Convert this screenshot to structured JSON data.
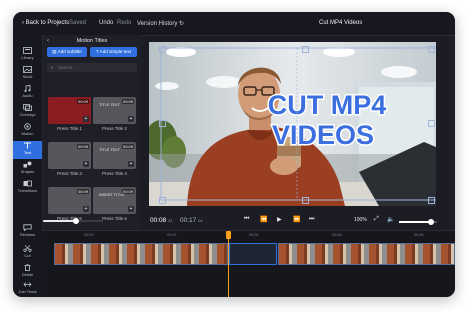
{
  "topbar": {
    "back": "‹ Back to Projects",
    "saved": "Saved",
    "undo": "Undo",
    "redo": "Redo",
    "version_history": "Version History",
    "project_title": "Cut MP4 Videos"
  },
  "rail": {
    "items": [
      {
        "label": "Library",
        "icon": "library-icon"
      },
      {
        "label": "Stock",
        "icon": "stock-icon"
      },
      {
        "label": "Audio",
        "icon": "music-icon"
      },
      {
        "label": "Overlays",
        "icon": "overlays-icon"
      },
      {
        "label": "Motion",
        "icon": "motion-icon"
      },
      {
        "label": "Text",
        "icon": "text-icon",
        "active": true
      },
      {
        "label": "Shapes",
        "icon": "shapes-icon"
      },
      {
        "label": "Transitions",
        "icon": "transitions-icon"
      }
    ],
    "bottom_items": [
      {
        "label": "Reviews",
        "icon": "reviews-icon"
      },
      {
        "label": "Cut",
        "icon": "cut-icon"
      },
      {
        "label": "Delete",
        "icon": "delete-icon"
      },
      {
        "label": "Join Track",
        "icon": "join-icon"
      }
    ]
  },
  "panel": {
    "title": "Motion Titles",
    "add_subtitle": "Add subtitle",
    "add_simple_text": "Add simple text",
    "search_placeholder": "Search...",
    "tiles": [
      {
        "label": "Press Title 1",
        "duration": "00:09",
        "color": "#8b1c22",
        "text": ""
      },
      {
        "label": "Press Title 2",
        "duration": "00:09",
        "color": "#56575d",
        "text": "TITLE TEXT"
      },
      {
        "label": "Press Title 3",
        "duration": "00:09",
        "color": "#56575d",
        "text": ""
      },
      {
        "label": "Press Title 4",
        "duration": "00:09",
        "color": "#56575d",
        "text": "TITLE TEXT"
      },
      {
        "label": "Press Title 5",
        "duration": "00:09",
        "color": "#56575d",
        "text": ""
      },
      {
        "label": "Press Title 6",
        "duration": "00:09",
        "color": "#56575d",
        "text": "INSERT TITLE"
      }
    ],
    "tile_add_symbol": "+",
    "size_slider_level": 0.55
  },
  "preview": {
    "title_line1": "CUT MP4",
    "title_line2": "VIDEOS",
    "title_color": "#3b6fe0"
  },
  "controls": {
    "current_time": "00:08",
    "current_frames": "21",
    "total_time": "00:17",
    "total_frames": "04",
    "zoom": "100%",
    "volume_level": 0.85
  },
  "timeline": {
    "ruler_labels": [
      "00:00",
      "00:02",
      "00:04",
      "00:06",
      "00:08",
      "00:10",
      "00:12"
    ],
    "playhead_time": "00:08"
  },
  "colors": {
    "accent": "#2f6fe0",
    "playhead": "#ff9f1a",
    "background": "#1c1d24"
  }
}
